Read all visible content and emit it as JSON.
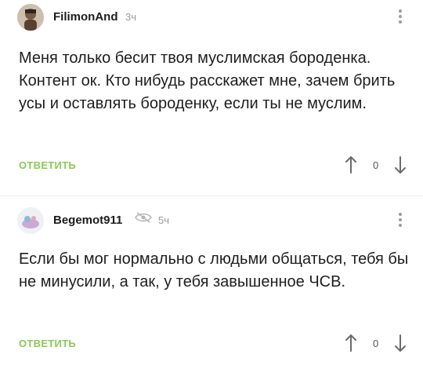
{
  "comments": [
    {
      "username": "FilimonAnd",
      "time": "3ч",
      "text": "Меня только бесит твоя муслимская бороденка. Контент ок. Кто нибудь расскажет мне, зачем брить усы и оставлять бороденку, если ты не муслим.",
      "reply_label": "ОТВЕТИТЬ",
      "rating": "0",
      "avatar_icon": "user-avatar",
      "colors": {
        "reply": "#8ac858"
      }
    },
    {
      "username": "Begemot911",
      "time": "5ч",
      "text": "Если бы мог нормально с людьми общаться, тебя бы не минусили, а так, у тебя завышенное ЧСВ.",
      "reply_label": "ОТВЕТИТЬ",
      "rating": "0",
      "avatar_icon": "user-avatar",
      "status_icon": "hidden-eye-icon",
      "colors": {
        "reply": "#8ac858"
      }
    }
  ]
}
